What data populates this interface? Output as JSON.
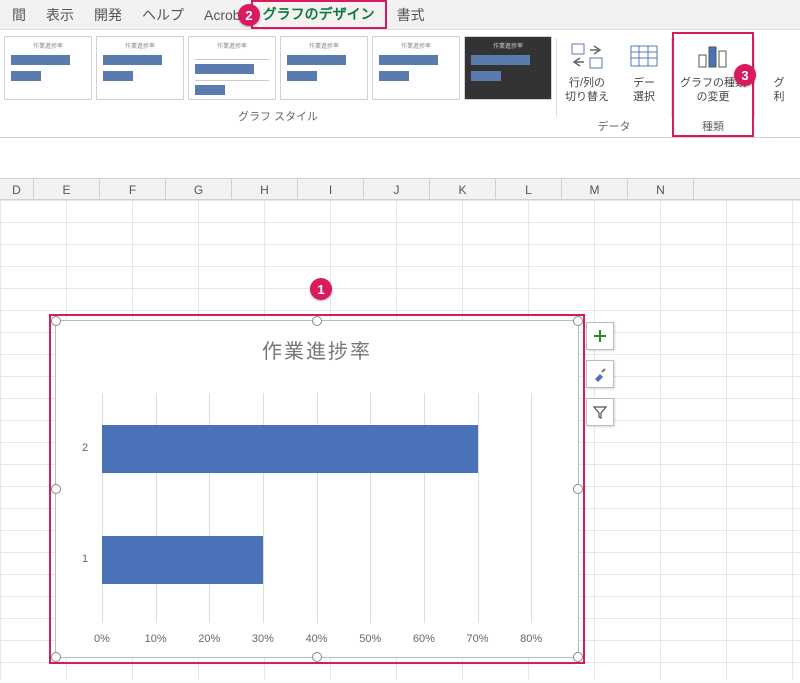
{
  "menu": {
    "items": [
      "間",
      "表示",
      "開発",
      "ヘルプ",
      "Acrob",
      "グラフのデザイン",
      "書式"
    ],
    "active_index": 5
  },
  "ribbon": {
    "styles_group_label": "グラフ スタイル",
    "data_group_label": "データ",
    "type_group_label": "種類",
    "switch_rowcol": "行/列の\n切り替え",
    "select_data": "デー\n選択",
    "change_type": "グラフの種類\nの変更",
    "right_cut": "グ\n利"
  },
  "badges": {
    "b1": "1",
    "b2": "2",
    "b3": "3"
  },
  "columns": [
    "D",
    "E",
    "F",
    "G",
    "H",
    "I",
    "J",
    "K",
    "L",
    "M",
    "N"
  ],
  "chart_side": [
    "plus",
    "brush",
    "funnel"
  ],
  "chart_data": {
    "type": "bar",
    "title": "作業進捗率",
    "categories": [
      "1",
      "2"
    ],
    "values": [
      30,
      70
    ],
    "xlabel": "",
    "ylabel": "",
    "xticks": [
      0,
      10,
      20,
      30,
      40,
      50,
      60,
      70,
      80
    ],
    "xtick_labels": [
      "0%",
      "10%",
      "20%",
      "30%",
      "40%",
      "50%",
      "60%",
      "70%",
      "80%"
    ],
    "xlim": [
      0,
      85
    ]
  }
}
